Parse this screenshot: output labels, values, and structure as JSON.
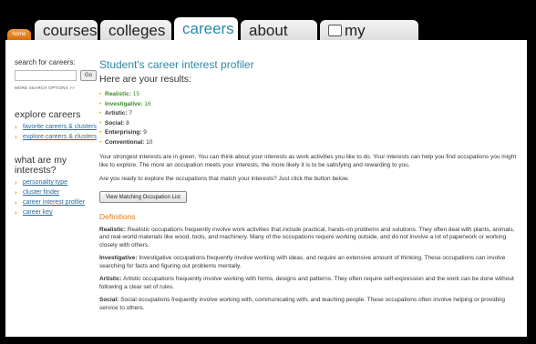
{
  "nav": {
    "home": "home",
    "tabs": [
      {
        "label": "courses"
      },
      {
        "label": "colleges"
      },
      {
        "label": "careers"
      },
      {
        "label": "about me"
      },
      {
        "label": "my planner"
      }
    ]
  },
  "sidebar": {
    "search_label": "search for careers:",
    "search_placeholder": "",
    "go_label": "Go",
    "more_search": "MORE SEARCH OPTIONS >>",
    "explore_heading": "explore careers",
    "explore_items": [
      "favorite careers & clusters",
      "explore careers & clusters"
    ],
    "interests_heading": "what are my interests?",
    "interest_items": [
      "personality type",
      "cluster finder",
      "career interest profiler",
      "career key"
    ]
  },
  "main": {
    "title": "Student's career interest profiler",
    "subtitle": "Here are your results:",
    "results": [
      {
        "label": "Realistic:",
        "value": "15",
        "green": true
      },
      {
        "label": "Investigative:",
        "value": "16",
        "green": true
      },
      {
        "label": "Artistic:",
        "value": "7",
        "green": false
      },
      {
        "label": "Social:",
        "value": "8",
        "green": false
      },
      {
        "label": "Enterprising:",
        "value": "9",
        "green": false
      },
      {
        "label": "Conventional:",
        "value": "10",
        "green": false
      }
    ],
    "para1": "Your strongest interests are in green. You can think about your interests as work activities you like to do. Your interests can help you find occupations you might like to explore. The more an occupation meets your interests, the more likely it is to be satisfying and rewarding to you.",
    "para2": "Are you ready to explore the occupations that match your interests? Just click the button below.",
    "view_button": "View Matching Occupation List",
    "definitions_heading": "Definitions",
    "definitions": [
      {
        "term": "Realistic:",
        "text": " Realistic occupations frequently involve work activities that include practical, hands-on problems and solutions. They often deal with plants, animals, and real-world materials like wood, tools, and machinery. Many of the occupations require working outside, and do not involve a lot of paperwork or working closely with others."
      },
      {
        "term": "Investigative:",
        "text": " Investigative occupations frequently involve working with ideas, and require an extensive amount of thinking. These occupations can involve searching for facts and figuring out problems mentally."
      },
      {
        "term": "Artistic:",
        "text": " Artistic occupations frequently involve working with forms, designs and patterns. They often require self-expression and the work can be done without following a clear set of rules."
      },
      {
        "term": "Social:",
        "text": " Social occupations frequently involve working with, communicating with, and teaching people. These occupations often involve helping or providing service to others."
      }
    ]
  }
}
